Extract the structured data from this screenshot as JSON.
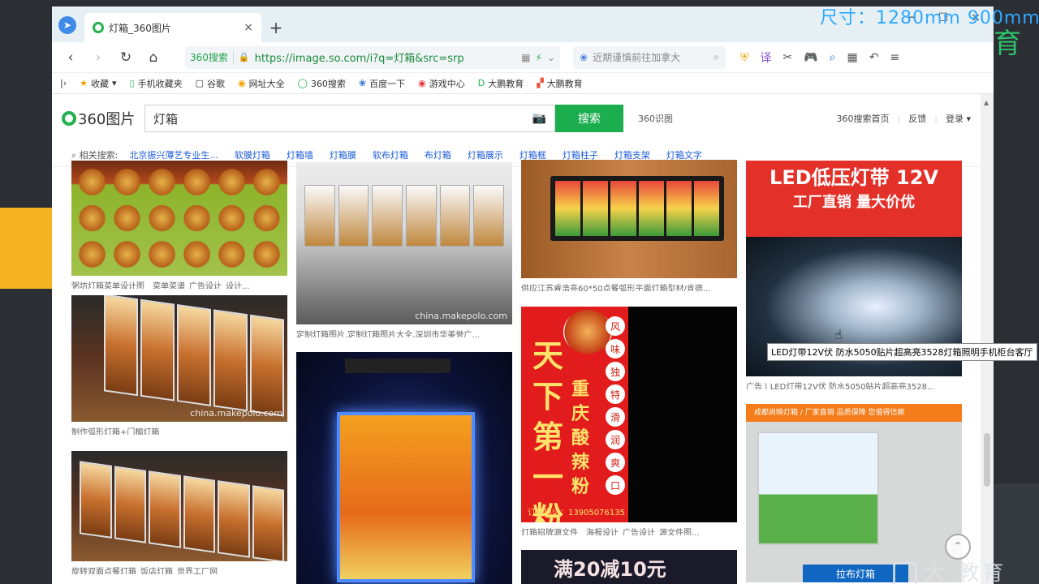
{
  "overlay": {
    "size_text": "尺寸：1280mm  900mm",
    "corner_char": "育",
    "watermark": "大  教育"
  },
  "tab": {
    "title": "灯箱_360图片",
    "close": "×",
    "new": "+"
  },
  "window": {
    "min": "─",
    "max": "☐",
    "close": "×"
  },
  "toolbar": {
    "back": "‹",
    "forward": "›",
    "reload": "↻",
    "home": "⌂",
    "address": {
      "secure_label": "360搜索",
      "url": "https://image.so.com/i?q=灯箱&src=srp"
    },
    "search_placeholder": "近期谨慎前往加拿大"
  },
  "bookmarks": [
    "收藏",
    "手机收藏夹",
    "谷歌",
    "网址大全",
    "360搜索",
    "百度一下",
    "游戏中心",
    "大鹏教育",
    "大鹏教育"
  ],
  "site": {
    "logo": "360图片",
    "query": "灯箱",
    "search_button": "搜索",
    "shitu": "360识图",
    "links": [
      "360搜索首页",
      "反馈",
      "登录"
    ]
  },
  "related": {
    "label": "相关搜索:",
    "items": [
      "北京振兴薄艺专业生...",
      "软膜灯箱",
      "灯箱墙",
      "灯箱膜",
      "软布灯箱",
      "布灯箱",
      "灯箱展示",
      "灯箱框",
      "灯箱柱子",
      "灯箱支架",
      "灯箱文字"
    ]
  },
  "results": [
    {
      "caption": "粥坊灯箱菜单设计图__菜单菜谱_广告设计_设计...",
      "watermark": ""
    },
    {
      "caption": "制作弧形灯箱+门楣灯箱",
      "watermark": "china.makepolo.com"
    },
    {
      "caption": "旋转双面点餐灯箱_饭店灯箱_世界工厂网",
      "watermark": ""
    },
    {
      "caption": "定制灯箱图片,定制灯箱图片大全,深圳市华美誉广...",
      "watermark": "china.makepolo.com"
    },
    {
      "caption": "",
      "watermark": ""
    },
    {
      "caption": "供应江苏睿浩亮60*50点餐弧形平面灯箱型材/肯德...",
      "watermark": ""
    },
    {
      "caption": "灯箱招牌源文件__海报设计_广告设计_源文件图...",
      "watermark": ""
    },
    {
      "caption": "",
      "overlay_text": "满20减10元"
    },
    {
      "caption": "广告 | LED灯带12V伏 防水5050贴片超高亮3528...",
      "line1": "LED低压灯带 12V",
      "line2": "工厂直销  量大价优"
    },
    {
      "caption": "",
      "top_text": "成都尚映灯箱 / 厂家直销  品质保障  您值得信赖",
      "bottom_text": "拉布灯箱"
    }
  ],
  "poster": {
    "big": "天下第一粉",
    "mid": "重庆酸辣粉",
    "circles": [
      "风",
      "味",
      "独",
      "特",
      "滑",
      "润",
      "爽",
      "口"
    ],
    "phone": "订餐电话：13905076135"
  },
  "tooltip": "LED灯带12V伏 防水5050贴片超高亮3528灯箱照明手机柜台客厅",
  "back_to_top": "⌃"
}
